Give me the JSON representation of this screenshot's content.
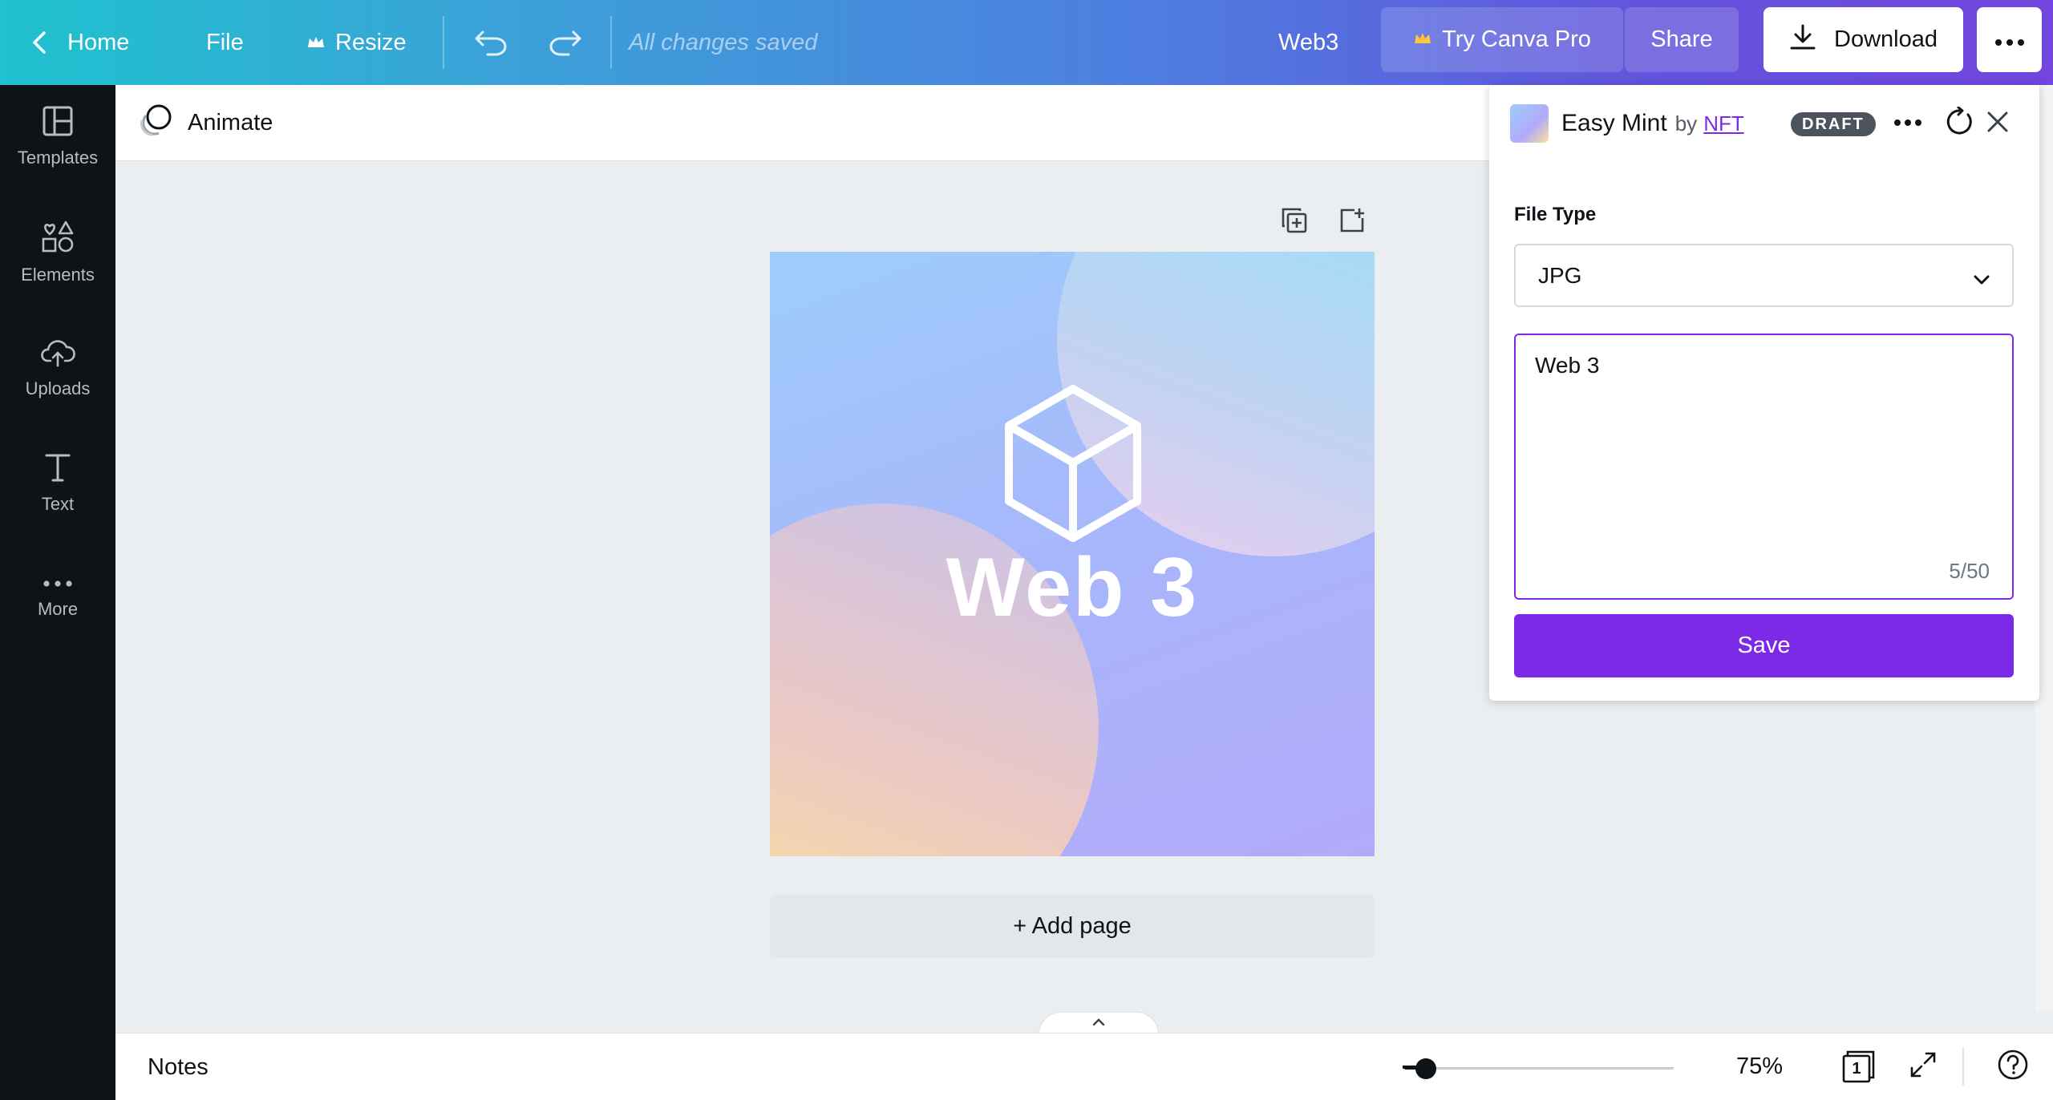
{
  "header": {
    "home_label": "Home",
    "file_label": "File",
    "resize_label": "Resize",
    "saved_status": "All changes saved",
    "doc_title": "Web3",
    "try_pro_label": "Try Canva Pro",
    "share_label": "Share",
    "download_label": "Download"
  },
  "sidebar": {
    "items": [
      {
        "label": "Templates",
        "icon": "templates-icon"
      },
      {
        "label": "Elements",
        "icon": "elements-icon"
      },
      {
        "label": "Uploads",
        "icon": "uploads-icon"
      },
      {
        "label": "Text",
        "icon": "text-icon"
      },
      {
        "label": "More",
        "icon": "more-icon"
      }
    ]
  },
  "toolbar": {
    "animate_label": "Animate"
  },
  "canvas": {
    "design_text": "Web 3",
    "add_page_label": "+ Add page"
  },
  "footer": {
    "notes_label": "Notes",
    "zoom_level": "75%",
    "zoom_fraction": 0.08,
    "page_count": "1"
  },
  "panel": {
    "app_name": "Easy Mint",
    "by_text": "by",
    "author": "NFT",
    "badge": "DRAFT",
    "file_type_label": "File Type",
    "file_type_value": "JPG",
    "name_value": "Web 3",
    "char_counter": "5/50",
    "save_label": "Save"
  },
  "colors": {
    "accent": "#7d2ae8",
    "crown": "#ffc53d",
    "sidebar_bg": "#0e1318"
  }
}
